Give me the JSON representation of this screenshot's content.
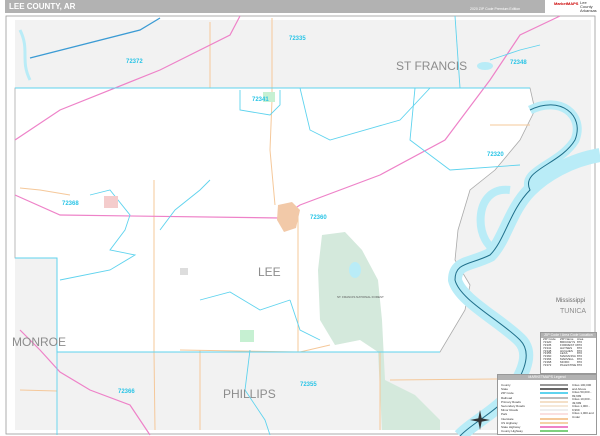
{
  "header": {
    "title": "LEE COUNTY, AR",
    "subtitle": "2020 ZIP Code Premium Edition",
    "logo_text": "MarketMAPS",
    "logo_side": "Lee County Arkansas"
  },
  "counties": {
    "lee": "LEE",
    "st_francis": "ST FRANCIS",
    "phillips": "PHILLIPS",
    "monroe": "MONROE",
    "tunica": "TUNICA",
    "mississippi_state": "Mississippi"
  },
  "zips": [
    "72335",
    "72372",
    "72348",
    "72341",
    "72320",
    "72368",
    "72360",
    "72366",
    "72355"
  ],
  "park_label": "ST. FRANCIS NATIONAL FOREST",
  "zip_table": {
    "title": "ZIP Code / Area Code Location",
    "headers": [
      "ZIP Code",
      "ZIP Name",
      "Area"
    ],
    "rows": [
      [
        "72320",
        "BRICKEYS",
        "870"
      ],
      [
        "72335",
        "FORREST CITY",
        "870"
      ],
      [
        "72341",
        "HAYNES",
        "870"
      ],
      [
        "72348",
        "HUGHES",
        "870"
      ],
      [
        "72355",
        "LEXA",
        "870"
      ],
      [
        "72360",
        "MARIANNA",
        "870"
      ],
      [
        "72366",
        "MARVELL",
        "870"
      ],
      [
        "72368",
        "MORO",
        "870"
      ],
      [
        "72372",
        "PALESTINE",
        "870"
      ]
    ]
  },
  "legend": {
    "title": "MARKETMAPS Legend",
    "items": [
      "County",
      "State",
      "ZIP Code",
      "Railroad",
      "Primary Roads",
      "Secondary Roads",
      "Minor Roads",
      "Park",
      "Interstate",
      "US Highway",
      "State Highway",
      "County Highway"
    ],
    "city_sizes": [
      "Cities 100,000 and Above",
      "Cities 50,000 - 99,999",
      "Cities 10,000 - 49,999",
      "Cities 1,000 - 9,999",
      "Cities 1,000 and Under"
    ]
  },
  "colors": {
    "zip_boundary": "#5fd3ee",
    "county_bg": "#f2f2f2",
    "lee_bg": "#ffffff",
    "water": "#b9ecf7",
    "forest": "#d4e9dc",
    "highway": "#ee82c8",
    "road": "#f5c89a",
    "river_line": "#1f6f8a",
    "city": "#f2c9a8"
  }
}
